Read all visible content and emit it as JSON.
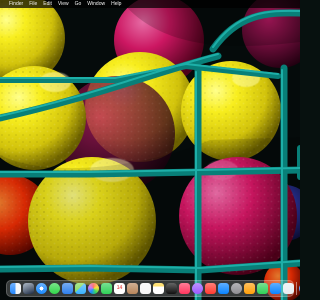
{
  "desktop": {
    "menu": [
      {
        "label": "Finder"
      },
      {
        "label": "File"
      },
      {
        "label": "Edit"
      },
      {
        "label": "View"
      },
      {
        "label": "Go"
      },
      {
        "label": "Window"
      },
      {
        "label": "Help"
      }
    ],
    "wallpaper": {
      "subject": "yellow and pink golf balls behind teal metal wire basket",
      "colors": {
        "yellow": "#f0df10",
        "pink": "#ec1a70",
        "red": "#ff2500",
        "teal": "#0d8f88",
        "dark": "#050b0b"
      }
    }
  },
  "dock": {
    "items": [
      {
        "name": "finder-icon"
      },
      {
        "name": "launchpad-icon"
      },
      {
        "name": "safari-icon"
      },
      {
        "name": "messages-icon"
      },
      {
        "name": "mail-icon"
      },
      {
        "name": "maps-icon"
      },
      {
        "name": "photos-icon"
      },
      {
        "name": "facetime-icon"
      },
      {
        "name": "calendar-icon",
        "text": "14"
      },
      {
        "name": "contacts-icon"
      },
      {
        "name": "reminders-icon"
      },
      {
        "name": "notes-icon"
      },
      {
        "name": "tv-icon"
      },
      {
        "name": "music-icon"
      },
      {
        "name": "podcasts-icon"
      },
      {
        "name": "news-icon"
      },
      {
        "name": "app-store-icon"
      },
      {
        "name": "system-settings-icon"
      },
      {
        "name": "pages-icon"
      },
      {
        "name": "numbers-icon"
      },
      {
        "name": "keynote-icon"
      },
      {
        "name": "preview-icon"
      },
      {
        "name": "downloads-icon"
      },
      {
        "name": "trash-icon"
      }
    ]
  }
}
